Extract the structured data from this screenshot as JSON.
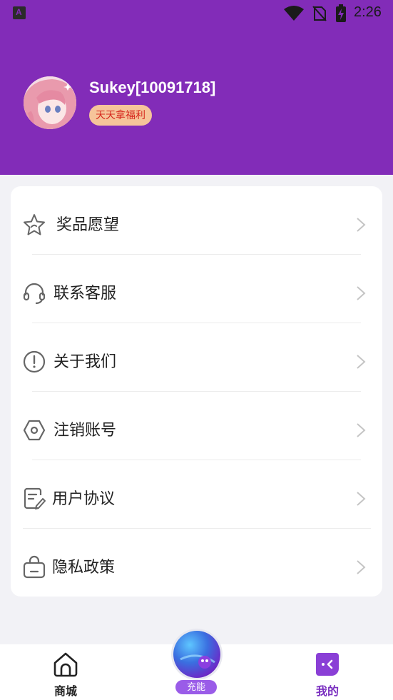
{
  "status_bar": {
    "time": "2:26"
  },
  "profile": {
    "username": "Sukey[10091718]",
    "badge": "天天拿福利"
  },
  "menu": [
    {
      "label": "奖品愿望",
      "icon": "star-icon"
    },
    {
      "label": "联系客服",
      "icon": "headset-icon"
    },
    {
      "label": "关于我们",
      "icon": "info-icon"
    },
    {
      "label": "注销账号",
      "icon": "hexagon-nut-icon"
    },
    {
      "label": "用户协议",
      "icon": "document-edit-icon"
    },
    {
      "label": "隐私政策",
      "icon": "lock-briefcase-icon"
    }
  ],
  "tabbar": {
    "home": "商城",
    "charge": "充能",
    "mine": "我的"
  },
  "colors": {
    "header": "#822cb8",
    "badge_bg": "#f6c49a",
    "badge_text": "#d6281e",
    "active_tab": "#7a2fc0",
    "charge_pill": "#9a5ce8"
  }
}
